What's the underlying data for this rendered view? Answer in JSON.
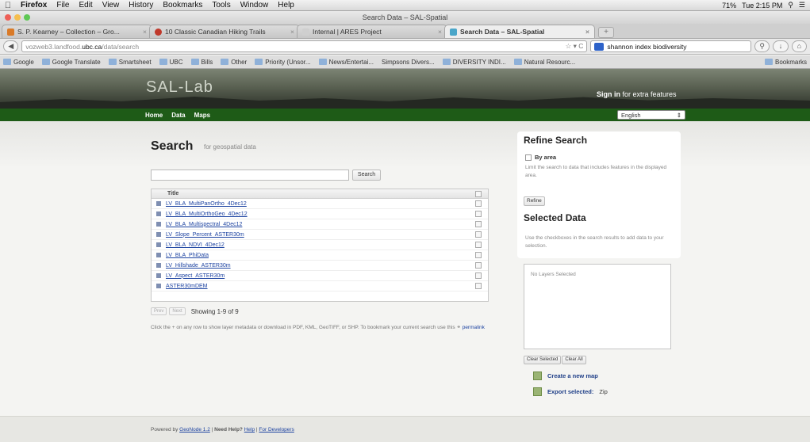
{
  "menubar": {
    "app": "Firefox",
    "items": [
      "File",
      "Edit",
      "View",
      "History",
      "Bookmarks",
      "Tools",
      "Window",
      "Help"
    ],
    "status": "71% ▭  ᛒ  ◯  ◀)  Tue 2:15 PM",
    "battery": "71%",
    "clock": "Tue 2:15 PM"
  },
  "window": {
    "title": "Search Data – SAL-Spatial"
  },
  "tabs": [
    {
      "label": "S. P. Kearney – Collection – Gro...",
      "icon_color": "#d97a28"
    },
    {
      "label": "10 Classic Canadian Hiking Trails",
      "icon_color": "#c0392b"
    },
    {
      "label": "Internal | ARES Project",
      "icon_color": "#cccccc"
    },
    {
      "label": "Search Data – SAL-Spatial",
      "icon_color": "#4aa6c9"
    }
  ],
  "address": {
    "prefix": "vozweb3.landfood.",
    "host": "ubc.ca",
    "path": "/data/search",
    "search_value": "shannon index biodiversity"
  },
  "bookmarks": [
    "Google",
    "Google Translate",
    "Smartsheet",
    "UBC",
    "Bills",
    "Other",
    "Priority (Unsor...",
    "News/Entertai...",
    "Simpsons Divers...",
    "DIVERSITY INDI...",
    "Natural Resourc...",
    "Bookmarks"
  ],
  "site": {
    "logo": "SAL-Lab",
    "signin_bold": "Sign in",
    "signin_rest": " for extra features",
    "nav": [
      "Home",
      "Data",
      "Maps"
    ],
    "language": "English"
  },
  "search": {
    "title": "Search",
    "subtitle": "for geospatial data",
    "button": "Search",
    "column_title": "Title",
    "rows": [
      "LV_BLA_MultiPanOrtho_4Dec12",
      "LV_BLA_MultiOrthoGeo_4Dec12",
      "LV_BLA_Multispectral_4Dec12",
      "LV_Slope_Percent_ASTER30m",
      "LV_BLA_NDVI_4Dec12",
      "LV_BLA_PhiData",
      "LV_Hillshade_ASTER30m",
      "LV_Aspect_ASTER30m",
      "ASTER30mDEM"
    ],
    "prev": "Prev",
    "next": "Next",
    "showing": "Showing 1-9 of 9",
    "help_text": "Click the + on any row to show layer metadata or download in PDF, KML, GeoTIFF, or SHP. To bookmark your current search use this",
    "permalink": "permalink"
  },
  "refine": {
    "title": "Refine Search",
    "by_area": "By area",
    "limit_text": "Limit the search to data that includes features in the displayed area.",
    "button": "Refine"
  },
  "selected": {
    "title": "Selected Data",
    "help": "Use the checkboxes in the search results to add data to your selection.",
    "empty": "No Layers Selected",
    "clear_selected": "Clear Selected",
    "clear_all": "Clear All",
    "create_map": "Create a new map",
    "export": "Export selected:",
    "export_format": "Zip"
  },
  "footer": {
    "powered": "Powered by ",
    "geonode": "GeoNode 1.2",
    "sep1": " | ",
    "need_help": "Need Help?",
    "help": "Help",
    "sep2": " | ",
    "developers": "For Developers"
  }
}
